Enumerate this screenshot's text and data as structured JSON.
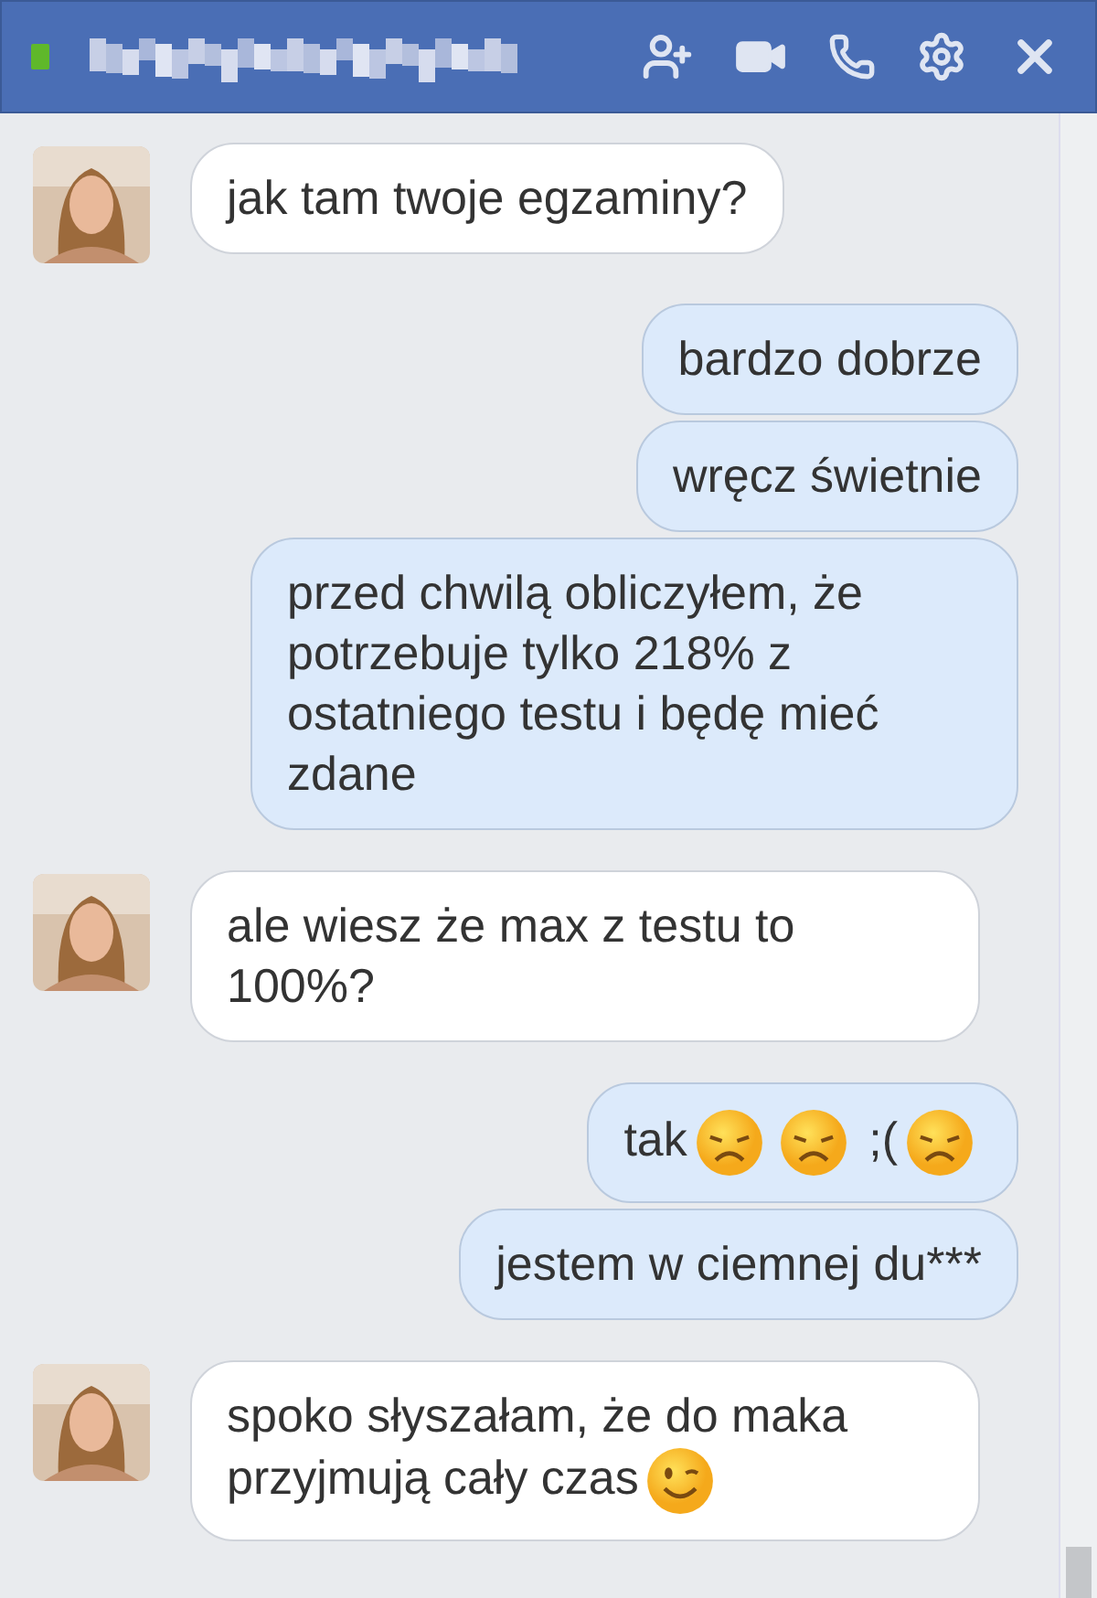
{
  "header": {
    "online": true
  },
  "groups": [
    {
      "mine": false,
      "messages": [
        {
          "parts": [
            {
              "kind": "text",
              "text": "jak tam twoje egzaminy?"
            }
          ]
        }
      ]
    },
    {
      "mine": true,
      "messages": [
        {
          "parts": [
            {
              "kind": "text",
              "text": "bardzo dobrze"
            }
          ]
        },
        {
          "parts": [
            {
              "kind": "text",
              "text": "wręcz świetnie"
            }
          ]
        },
        {
          "parts": [
            {
              "kind": "text",
              "text": "przed chwilą obliczyłem, że potrzebuje tylko 218% z ostatniego testu i będę mieć zdane"
            }
          ]
        }
      ]
    },
    {
      "mine": false,
      "messages": [
        {
          "parts": [
            {
              "kind": "text",
              "text": "ale wiesz że max z testu to 100%?"
            }
          ]
        }
      ]
    },
    {
      "mine": true,
      "messages": [
        {
          "parts": [
            {
              "kind": "text",
              "text": "tak"
            },
            {
              "kind": "sad"
            },
            {
              "kind": "sad"
            },
            {
              "kind": "text",
              "text": ";("
            },
            {
              "kind": "sad"
            }
          ]
        },
        {
          "parts": [
            {
              "kind": "text",
              "text": "jestem w ciemnej du***"
            }
          ]
        }
      ]
    },
    {
      "mine": false,
      "messages": [
        {
          "parts": [
            {
              "kind": "text",
              "text": "spoko słyszałam, że do maka przyjmują cały czas"
            },
            {
              "kind": "wink"
            }
          ]
        }
      ]
    }
  ]
}
